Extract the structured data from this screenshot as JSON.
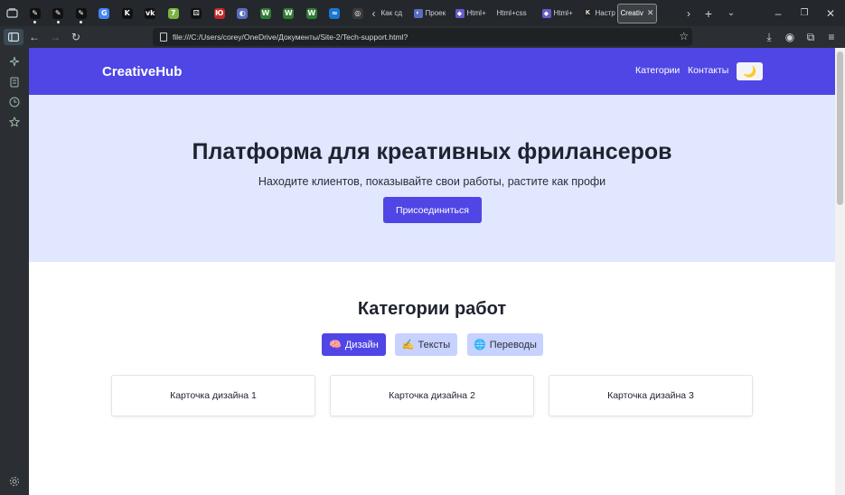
{
  "browser": {
    "pinned_tabs": [
      {
        "icon": "pen-nib-icon",
        "color": "#111111",
        "glyph": "✎",
        "dot": true
      },
      {
        "icon": "pen-nib-icon",
        "color": "#111111",
        "glyph": "✎",
        "dot": true
      },
      {
        "icon": "pen-nib-icon",
        "color": "#111111",
        "glyph": "✎",
        "dot": true
      },
      {
        "icon": "google-icon",
        "color": "#4285f4",
        "glyph": "G",
        "dot": false
      },
      {
        "icon": "k-logo-icon",
        "color": "#111111",
        "glyph": "K",
        "dot": false
      },
      {
        "icon": "vk-icon",
        "color": "#111111",
        "glyph": "vk",
        "dot": false
      },
      {
        "icon": "green-square-icon",
        "color": "#7cb342",
        "glyph": "7",
        "dot": false
      },
      {
        "icon": "dice-icon",
        "color": "#111111",
        "glyph": "⚄",
        "dot": false
      },
      {
        "icon": "red-logo-icon",
        "color": "#c62828",
        "glyph": "Ю",
        "dot": false
      },
      {
        "icon": "globe-icon",
        "color": "#5c6bc0",
        "glyph": "◐",
        "dot": false
      },
      {
        "icon": "w-logo-icon",
        "color": "#2e7d32",
        "glyph": "W",
        "dot": false
      },
      {
        "icon": "w-logo-icon",
        "color": "#2e7d32",
        "glyph": "W",
        "dot": false
      },
      {
        "icon": "w-logo-icon",
        "color": "#2e7d32",
        "glyph": "W",
        "dot": false
      },
      {
        "icon": "wave-icon",
        "color": "#1976d2",
        "glyph": "≈",
        "dot": false
      },
      {
        "icon": "openai-icon",
        "color": "#3a3a3a",
        "glyph": "◎",
        "dot": false
      }
    ],
    "tabs": [
      {
        "title": "Как сд",
        "icon": "",
        "active": false
      },
      {
        "title": "Проек",
        "icon": "blue-globe-icon",
        "active": false
      },
      {
        "title": "Html+",
        "icon": "shield-icon",
        "active": false
      },
      {
        "title": "Html+css",
        "icon": "",
        "active": false
      },
      {
        "title": "Html+",
        "icon": "shield-icon",
        "active": false
      },
      {
        "title": "Настр",
        "icon": "k-logo-icon",
        "active": false
      },
      {
        "title": "Creativ",
        "icon": "",
        "active": true
      }
    ],
    "url": "file:///C:/Users/corey/OneDrive/Документы/Site-2/Tech-support.html?"
  },
  "site": {
    "brand": "CreativeHub",
    "nav": [
      "Категории",
      "Контакты"
    ],
    "theme_toggle": "🌙",
    "hero": {
      "title": "Платформа для креативных фрилансеров",
      "subtitle": "Находите клиентов, показывайте свои работы, растите как профи",
      "cta": "Присоединиться"
    },
    "categories": {
      "title": "Категории работ",
      "filters": [
        {
          "emoji": "🧠",
          "label": "Дизайн",
          "active": true
        },
        {
          "emoji": "✍️",
          "label": "Тексты",
          "active": false
        },
        {
          "emoji": "🌐",
          "label": "Переводы",
          "active": false
        }
      ],
      "cards": [
        "Карточка дизайна 1",
        "Карточка дизайна 2",
        "Карточка дизайна 3"
      ]
    },
    "colors": {
      "primary": "#4f46e5",
      "hero_bg": "#e0e7ff",
      "filter_inactive": "#c7d2fe"
    }
  }
}
